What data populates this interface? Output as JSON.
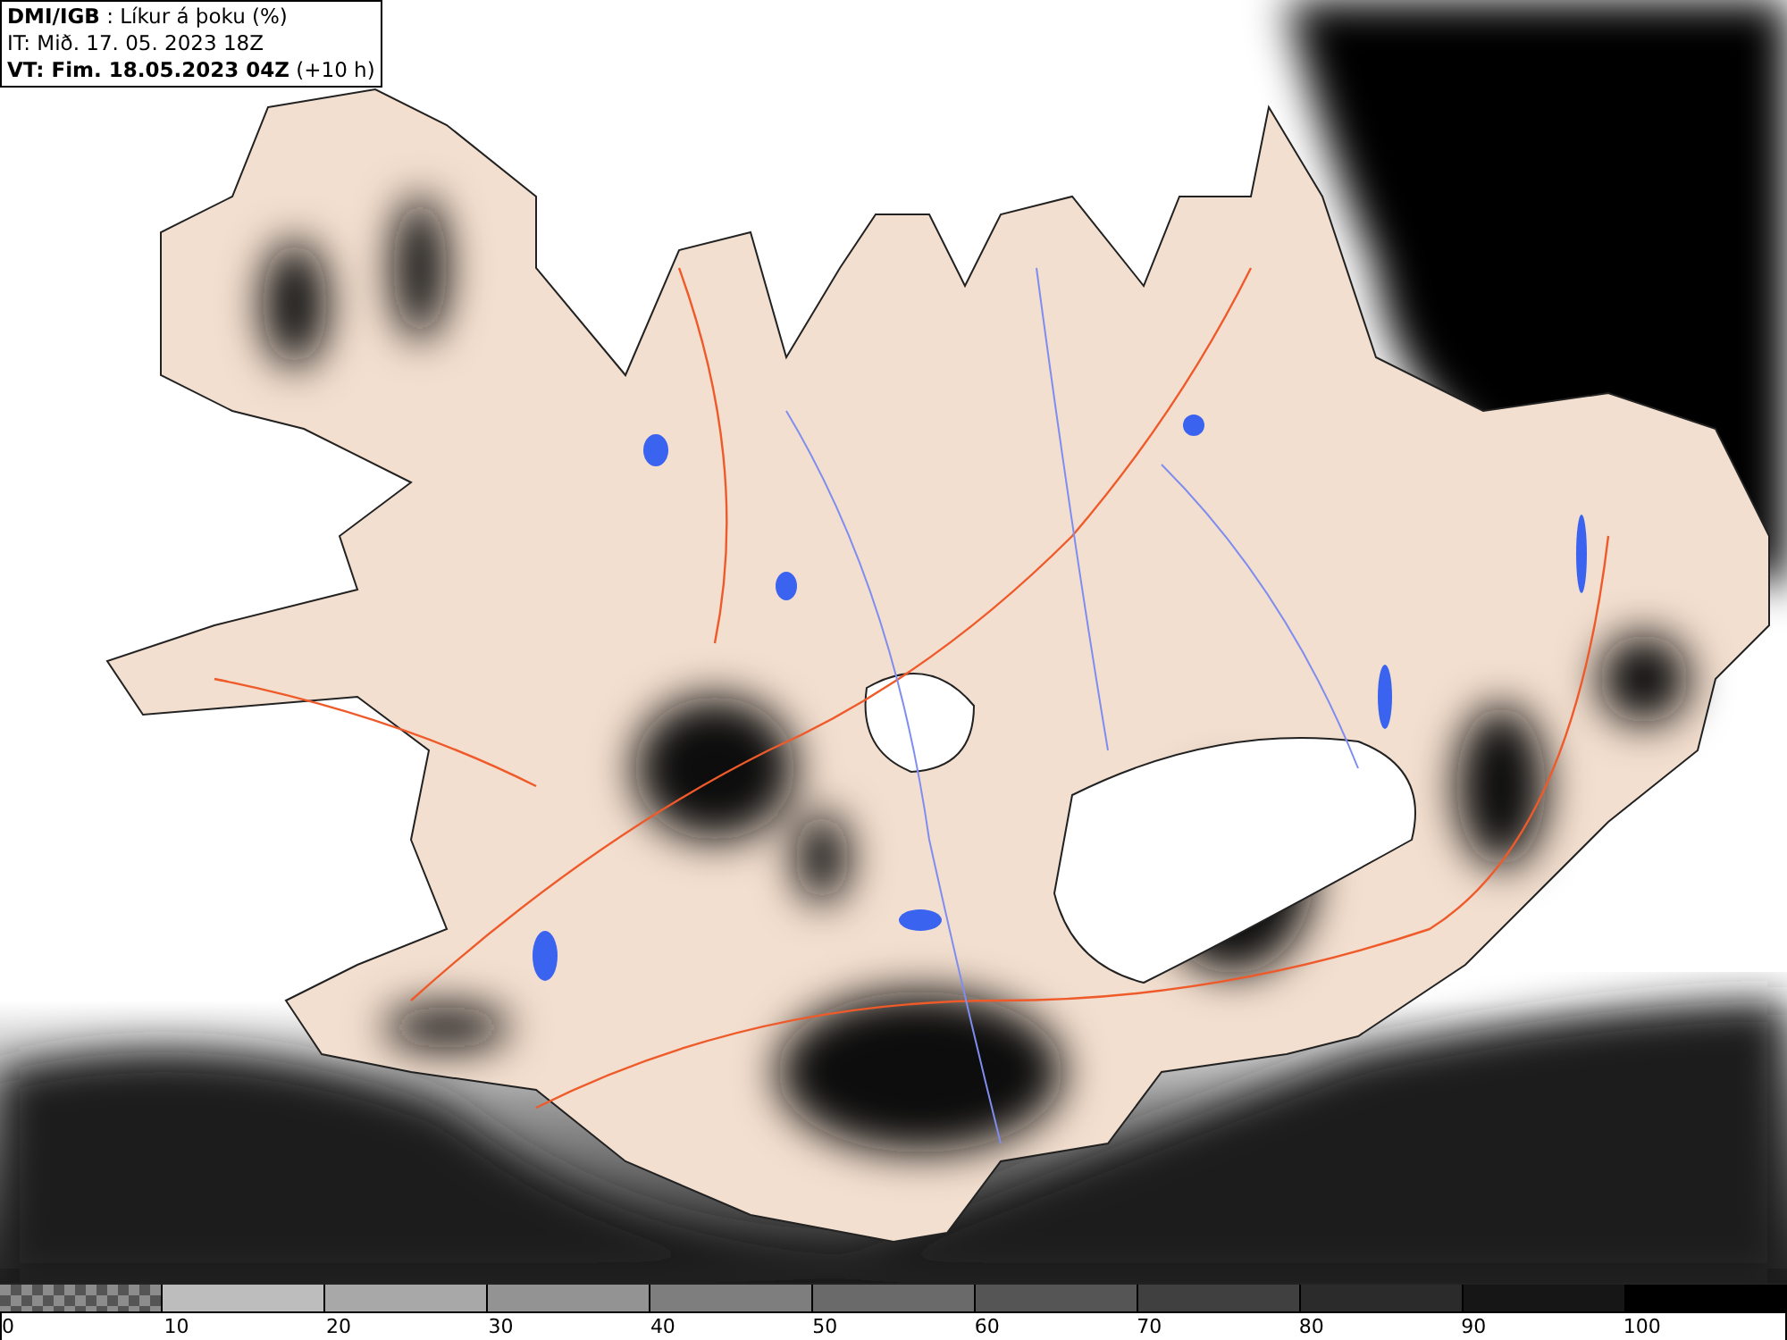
{
  "header": {
    "lines": [
      "**DMI/IGB** : Líkur á þoku (%)",
      "IT: Mið. 17. 05. 2023 18Z",
      "**VT: Fim. 18.05.2023 04Z** (+10 h)"
    ]
  },
  "legend": [
    {
      "label": "0",
      "kind": "checkered",
      "color": "#8c8c8c"
    },
    {
      "label": "10",
      "kind": "solid",
      "color": "#bdbdbd"
    },
    {
      "label": "20",
      "kind": "solid",
      "color": "#a8a8a8"
    },
    {
      "label": "30",
      "kind": "solid",
      "color": "#939393"
    },
    {
      "label": "40",
      "kind": "solid",
      "color": "#7e7e7e"
    },
    {
      "label": "50",
      "kind": "solid",
      "color": "#6a6a6a"
    },
    {
      "label": "60",
      "kind": "solid",
      "color": "#555555"
    },
    {
      "label": "70",
      "kind": "solid",
      "color": "#404040"
    },
    {
      "label": "80",
      "kind": "solid",
      "color": "#2b2b2b"
    },
    {
      "label": "90",
      "kind": "solid",
      "color": "#161616"
    },
    {
      "label": "100",
      "kind": "solid",
      "color": "#000000"
    }
  ]
}
